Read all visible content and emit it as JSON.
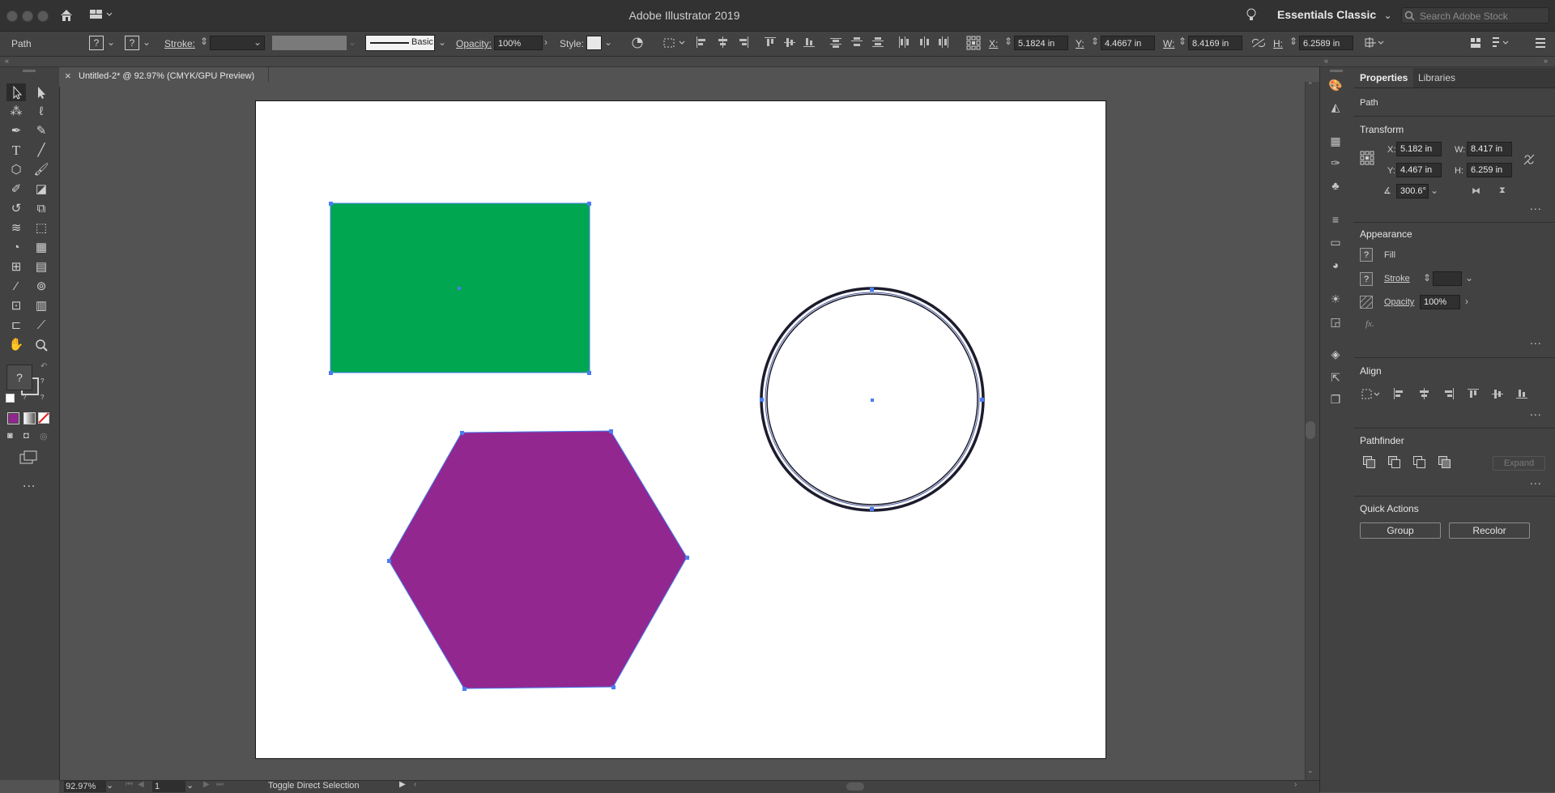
{
  "app": {
    "title": "Adobe Illustrator 2019",
    "workspace": "Essentials Classic",
    "stock_placeholder": "Search Adobe Stock"
  },
  "controlbar": {
    "selection": "Path",
    "fill_value": "?",
    "stroke_value": "?",
    "stroke_label": "Stroke:",
    "stroke_profile": "Basic",
    "opacity_label": "Opacity:",
    "opacity": "100%",
    "style_label": "Style:",
    "x_label": "X:",
    "x": "5.1824 in",
    "y_label": "Y:",
    "y": "4.4667 in",
    "w_label": "W:",
    "w": "8.4169 in",
    "h_label": "H:",
    "h": "6.2589 in"
  },
  "document": {
    "tab_title": "Untitled-2* @ 92.97% (CMYK/GPU Preview)",
    "close": "×"
  },
  "artwork": {
    "rectangle_fill": "#00a650",
    "hexagon_fill": "#92278f",
    "circle_stroke": "#1c1c2e",
    "selection_color": "#4a7cf0"
  },
  "tools": {
    "fill_swatch_color": "#92278f",
    "unknown": "?",
    "more": "..."
  },
  "status": {
    "zoom": "92.97%",
    "artboard_number": "1",
    "message": "Toggle Direct Selection"
  },
  "properties": {
    "tabs": [
      "Properties",
      "Libraries"
    ],
    "selection": "Path",
    "transform": {
      "title": "Transform",
      "x_label": "X:",
      "x": "5.182 in",
      "w_label": "W:",
      "w": "8.417 in",
      "y_label": "Y:",
      "y": "4.467 in",
      "h_label": "H:",
      "h": "6.259 in",
      "angle": "300.6°"
    },
    "appearance": {
      "title": "Appearance",
      "fill": "Fill",
      "stroke": "Stroke",
      "opacity_label": "Opacity",
      "opacity": "100%",
      "fx": "fx."
    },
    "align": {
      "title": "Align"
    },
    "pathfinder": {
      "title": "Pathfinder",
      "expand": "Expand"
    },
    "quick_actions": {
      "title": "Quick Actions",
      "group": "Group",
      "recolor": "Recolor"
    },
    "more": "..."
  }
}
